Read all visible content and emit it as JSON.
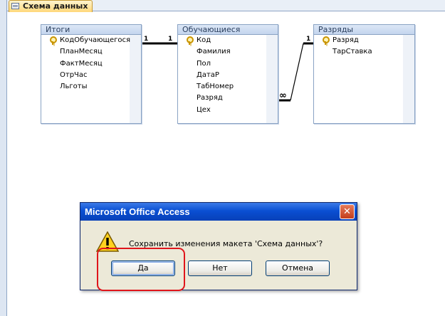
{
  "tab": {
    "label": "Схема данных",
    "icon": "relationships-icon"
  },
  "tables": {
    "itogi": {
      "title": "Итоги",
      "fields": [
        "КодОбучающегося",
        "ПланМесяц",
        "ФактМесяц",
        "ОтрЧас",
        "Льготы"
      ],
      "key_field": "КодОбучающегося"
    },
    "obuchayushchiesya": {
      "title": "Обучающиеся",
      "fields": [
        "Код",
        "Фамилия",
        "Пол",
        "ДатаР",
        "ТабНомер",
        "Разряд",
        "Цех"
      ],
      "key_field": "Код"
    },
    "razryady": {
      "title": "Разряды",
      "fields": [
        "Разряд",
        "ТарСтавка"
      ],
      "key_field": "Разряд"
    }
  },
  "relationships": [
    {
      "from": "Итоги.КодОбучающегося",
      "to": "Обучающиеся.Код",
      "from_label": "1",
      "to_label": "1"
    },
    {
      "from": "Обучающиеся.Разряд",
      "to": "Разряды.Разряд",
      "from_label": "∞",
      "to_label": "1"
    }
  ],
  "dialog": {
    "title": "Microsoft Office Access",
    "close_icon": "close-icon",
    "message": "Сохранить изменения макета 'Схема данных'?",
    "buttons": {
      "yes": "Да",
      "no": "Нет",
      "cancel": "Отмена"
    }
  },
  "colors": {
    "highlight": "#e0151b",
    "title_bar": "#0a4fd2",
    "table_header": "#c4d5ee"
  }
}
